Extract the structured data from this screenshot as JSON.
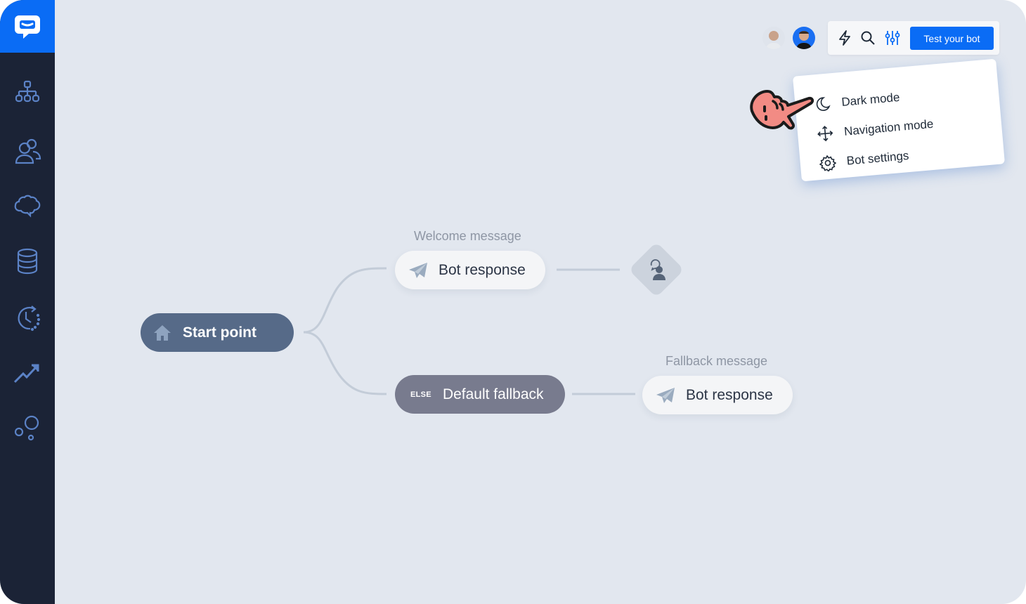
{
  "app": {
    "brand_color": "#0a6cf5",
    "sidebar_color": "#1b2336",
    "canvas_color": "#e2e7ef"
  },
  "sidebar": {
    "logo_icon": "chat-logo-icon",
    "items": [
      {
        "icon": "flow-chart-icon",
        "label": "Flows"
      },
      {
        "icon": "users-icon",
        "label": "Audience"
      },
      {
        "icon": "brain-icon",
        "label": "Training"
      },
      {
        "icon": "database-icon",
        "label": "Data"
      },
      {
        "icon": "history-clock-icon",
        "label": "History"
      },
      {
        "icon": "trend-up-icon",
        "label": "Reports"
      },
      {
        "icon": "bubbles-icon",
        "label": "Integrations"
      }
    ]
  },
  "toolbar": {
    "avatars": [
      "user-avatar-1",
      "user-avatar-2"
    ],
    "icons": [
      "lightning-icon",
      "search-icon",
      "sliders-icon"
    ],
    "test_button": "Test your bot"
  },
  "menu": {
    "items": [
      {
        "icon": "moon-icon",
        "label": "Dark mode"
      },
      {
        "icon": "move-arrows-icon",
        "label": "Navigation mode"
      },
      {
        "icon": "gear-icon",
        "label": "Bot settings"
      }
    ]
  },
  "flow": {
    "start": {
      "label": "Start point",
      "icon": "home-icon"
    },
    "welcome": {
      "caption": "Welcome message",
      "label": "Bot response",
      "icon": "paper-plane-icon"
    },
    "handoff": {
      "icon": "agent-handoff-icon"
    },
    "fallback_branch": {
      "tag": "ELSE",
      "label": "Default fallback"
    },
    "fallback": {
      "caption": "Fallback message",
      "label": "Bot response",
      "icon": "paper-plane-icon"
    }
  }
}
